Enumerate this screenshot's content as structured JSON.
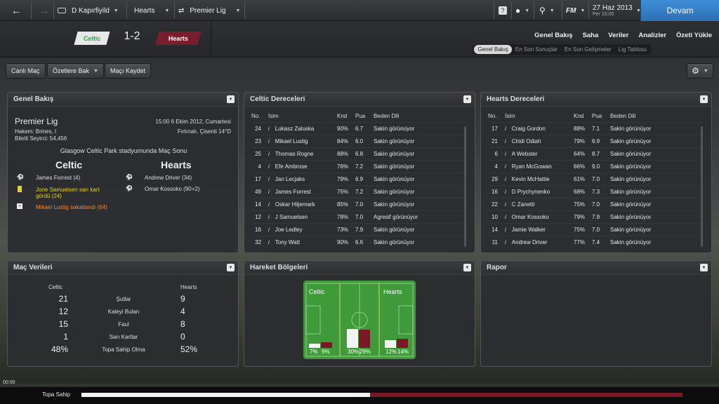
{
  "topbar": {
    "breadcrumb_1": "D Kapırfiyild",
    "breadcrumb_2": "Hearts",
    "breadcrumb_3": "Premier Lig",
    "date": "27 Haz 2013",
    "day_time": "Per 15:00",
    "fm_label": "FM",
    "continue_label": "Devam"
  },
  "header": {
    "home_team": "Celtic",
    "away_team": "Hearts",
    "score": "1-2",
    "nav": [
      "Genel Bakış",
      "Saha",
      "Veriler",
      "Analizler",
      "Özeti Yükle"
    ],
    "subtabs": [
      "Genel Bakış",
      "En Son Sonuçlar",
      "En Son Gelişmeler",
      "Lig Tablosu"
    ]
  },
  "toolbar": {
    "live_match": "Canlı Maç",
    "highlights": "Özetlere Bak",
    "save_match": "Maçı Kaydet"
  },
  "overview": {
    "title": "Genel Bakış",
    "competition": "Premier Lig",
    "datetime": "15:00 6 Ekim 2012, Cumartesi",
    "referee": "Hakem: Brines, I",
    "weather": "Fırtınalı, Çisenti 14°D",
    "attendance": "Biletli Seyirci: 54,456",
    "venue": "Glasgow Celtic Park stadyumunda Maç Sonu",
    "home_team": "Celtic",
    "away_team": "Hearts",
    "home_events": [
      {
        "icon": "ball-icon",
        "text": "James Forrest (4)",
        "type": "goal"
      },
      {
        "icon": "yellow-card-icon",
        "text": "Jone Samuelsen sarı kart",
        "type": "card"
      },
      {
        "icon": "",
        "text": "gördü (24)",
        "type": "card"
      },
      {
        "icon": "injury-icon",
        "text": "Mikael Lustig sakatlandı (64)",
        "type": "injury"
      }
    ],
    "away_events": [
      {
        "icon": "ball-icon",
        "text": "Andrew Driver (34)"
      },
      {
        "icon": "ball-icon",
        "text": "Omar Kossoko (90+2)"
      }
    ]
  },
  "celtic_ratings": {
    "title": "Celtic Dereceleri",
    "headers": [
      "No.",
      "İsim",
      "Knd",
      "Pua",
      "Beden Dili"
    ],
    "rows": [
      {
        "no": "24",
        "name": "Lukasz Zaluska",
        "knd": "90%",
        "pua": "6.7",
        "body": "Sakin görünüyor",
        "kcol": "g",
        "ncol": ""
      },
      {
        "no": "23",
        "name": "Mikael Lustig",
        "knd": "84%",
        "pua": "6.0",
        "body": "Sakin görünüyor",
        "kcol": "y",
        "ncol": "dim"
      },
      {
        "no": "25",
        "name": "Thomas Rogne",
        "knd": "88%",
        "pua": "6.8",
        "body": "Sakin görünüyor",
        "kcol": "g",
        "ncol": "dim"
      },
      {
        "no": "4",
        "name": "Efe Ambrose",
        "knd": "76%",
        "pua": "7.2",
        "body": "Sakin görünüyor",
        "kcol": "y",
        "ncol": ""
      },
      {
        "no": "17",
        "name": "Jan Lecjaks",
        "knd": "79%",
        "pua": "6.9",
        "body": "Sakin görünüyor",
        "kcol": "g",
        "ncol": ""
      },
      {
        "no": "49",
        "name": "James Forrest",
        "knd": "75%",
        "pua": "7.2",
        "body": "Sakin görünüyor",
        "kcol": "y",
        "ncol": ""
      },
      {
        "no": "14",
        "name": "Oskar Hiljemark",
        "knd": "85%",
        "pua": "7.0",
        "body": "Sakin görünüyor",
        "kcol": "g",
        "ncol": "dim"
      },
      {
        "no": "12",
        "name": "J Samuelsen",
        "knd": "78%",
        "pua": "7.0",
        "body": "Agresif görünüyor",
        "kcol": "g",
        "ncol": ""
      },
      {
        "no": "16",
        "name": "Joe Ledley",
        "knd": "73%",
        "pua": "7.9",
        "body": "Sakin görünüyor",
        "kcol": "y",
        "ncol": ""
      },
      {
        "no": "32",
        "name": "Tony Watt",
        "knd": "90%",
        "pua": "6.6",
        "body": "Sakin görünüyor",
        "kcol": "g",
        "ncol": "dim"
      }
    ]
  },
  "hearts_ratings": {
    "title": "Hearts Dereceleri",
    "headers": [
      "No.",
      "İsim",
      "Knd",
      "Pua",
      "Beden Dili"
    ],
    "rows": [
      {
        "no": "17",
        "name": "Craig Gordon",
        "knd": "88%",
        "pua": "7.1",
        "body": "Sakin görünüyor",
        "kcol": "g",
        "ncol": ""
      },
      {
        "no": "21",
        "name": "Chidi Odiah",
        "knd": "79%",
        "pua": "6.9",
        "body": "Sakin görünüyor",
        "kcol": "g",
        "ncol": ""
      },
      {
        "no": "6",
        "name": "A Webster",
        "knd": "64%",
        "pua": "8.7",
        "body": "Sakin görünüyor",
        "kcol": "y",
        "ncol": ""
      },
      {
        "no": "4",
        "name": "Ryan McGowan",
        "knd": "66%",
        "pua": "9.0",
        "body": "Sakin görünüyor",
        "kcol": "y",
        "ncol": "blue"
      },
      {
        "no": "29",
        "name": "Kevin McHattie",
        "knd": "61%",
        "pua": "7.0",
        "body": "Sakin görünüyor",
        "kcol": "y",
        "ncol": ""
      },
      {
        "no": "16",
        "name": "D Prychynenko",
        "knd": "68%",
        "pua": "7.3",
        "body": "Sakin görünüyor",
        "kcol": "y",
        "ncol": ""
      },
      {
        "no": "22",
        "name": "C Zanetti",
        "knd": "75%",
        "pua": "7.0",
        "body": "Sakin görünüyor",
        "kcol": "y",
        "ncol": ""
      },
      {
        "no": "10",
        "name": "Omar Kossoko",
        "knd": "79%",
        "pua": "7.9",
        "body": "Sakin görünüyor",
        "kcol": "g",
        "ncol": ""
      },
      {
        "no": "14",
        "name": "Jamie Walker",
        "knd": "75%",
        "pua": "7.0",
        "body": "Sakin görünüyor",
        "kcol": "y",
        "ncol": ""
      },
      {
        "no": "11",
        "name": "Andrew Driver",
        "knd": "77%",
        "pua": "7.4",
        "body": "Sakin görünüyor",
        "kcol": "y",
        "ncol": ""
      }
    ]
  },
  "match_stats": {
    "title": "Maç Verileri",
    "home": "Celtic",
    "away": "Hearts",
    "rows": [
      {
        "label": "Şutlar",
        "home": "21",
        "away": "9"
      },
      {
        "label": "Kaleyi Bulan",
        "home": "12",
        "away": "4"
      },
      {
        "label": "Faul",
        "home": "15",
        "away": "8"
      },
      {
        "label": "Sarı Kartlar",
        "home": "1",
        "away": "0"
      },
      {
        "label": "Topa Sahip Olma",
        "home": "48%",
        "away": "52%"
      }
    ]
  },
  "heatmap": {
    "title": "Hareket Bölgeleri",
    "home": "Celtic",
    "away": "Hearts",
    "zones": [
      {
        "home": 7,
        "away": 9,
        "home_label": "7%",
        "away_label": "9%"
      },
      {
        "home": 30,
        "away": 29,
        "home_label": "30%",
        "away_label": "29%"
      },
      {
        "home": 12,
        "away": 14,
        "home_label": "12%",
        "away_label": "14%"
      }
    ]
  },
  "report": {
    "title": "Rapor"
  },
  "bottom": {
    "clock": "00:00",
    "possession_label": "Topa Sahip",
    "home_possession": 48
  },
  "colors": {
    "accent": "#2d6fb6",
    "hearts": "#7a1826",
    "celtic": "#2aa84a",
    "pitch": "#3f9a3a"
  }
}
